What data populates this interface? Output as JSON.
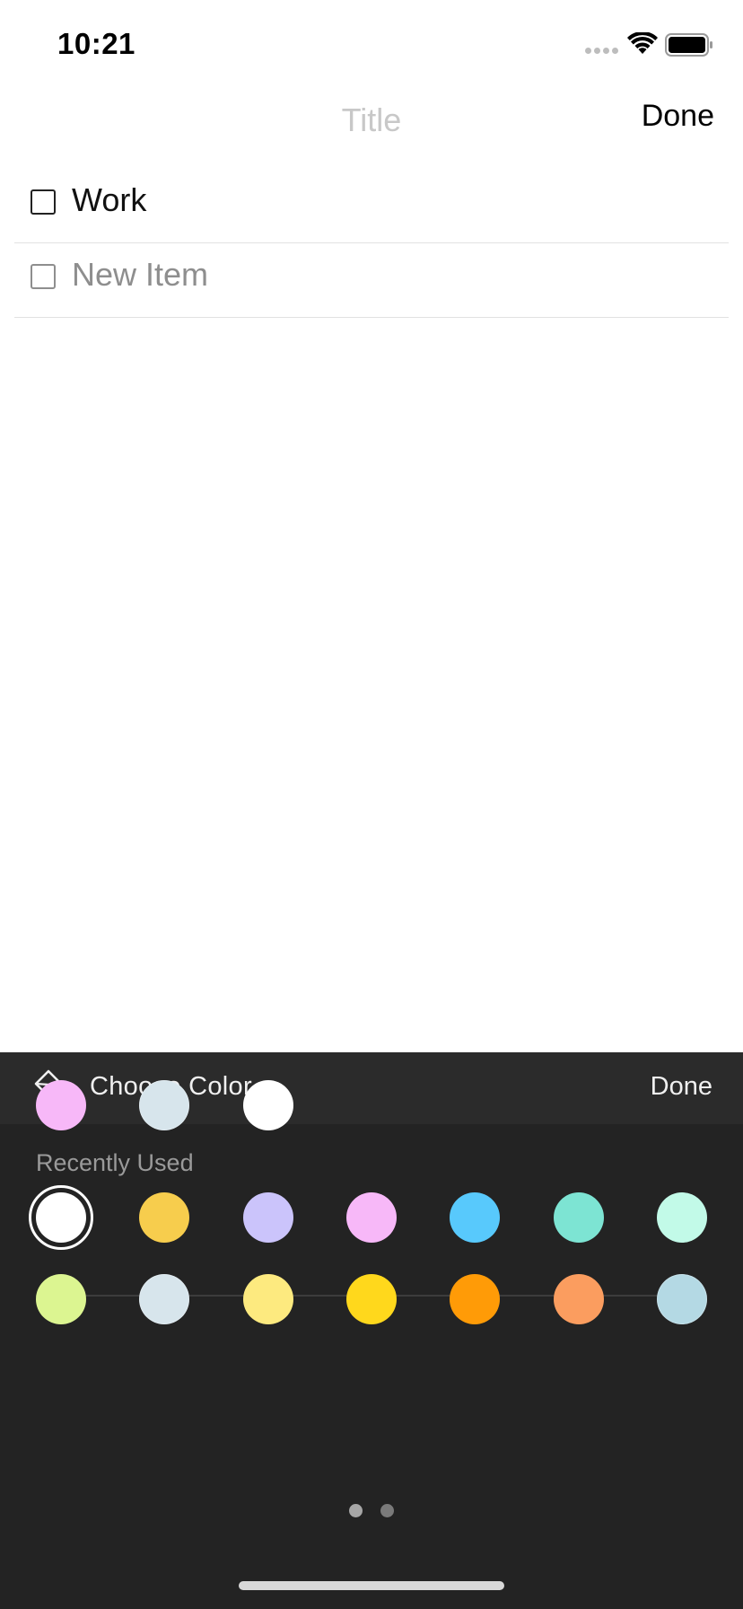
{
  "status_bar": {
    "time": "10:21",
    "icons": [
      "signal-dots-icon",
      "wifi-icon",
      "battery-icon"
    ]
  },
  "nav": {
    "title_placeholder": "Title",
    "done_label": "Done"
  },
  "checklist": {
    "items": [
      {
        "label": "Work",
        "checked": false,
        "placeholder": false
      },
      {
        "label": "New Item",
        "checked": false,
        "placeholder": true
      }
    ]
  },
  "color_panel": {
    "icon": "paint-bucket-icon",
    "title": "Choose Color",
    "done_label": "Done",
    "recent_label": "Recently Used",
    "recent_colors": [
      "#f7b8f8",
      "#d7e5ec",
      "#ffffff"
    ],
    "palette_row_1": [
      "#ffffff",
      "#f7cd4d",
      "#cbc4fb",
      "#f7b8f8",
      "#58c9fc",
      "#7de4d3",
      "#c2fae8"
    ],
    "palette_row_2": [
      "#dcf591",
      "#d7e5ec",
      "#fdea7f",
      "#ffd81c",
      "#ff9b07",
      "#fb9d5f",
      "#b4d9e4"
    ],
    "selected_color": "#ffffff",
    "pages": {
      "count": 2,
      "current": 1
    },
    "page_dot_colors": {
      "active": "#a6a6a6",
      "inactive": "#7a7a7a"
    }
  }
}
